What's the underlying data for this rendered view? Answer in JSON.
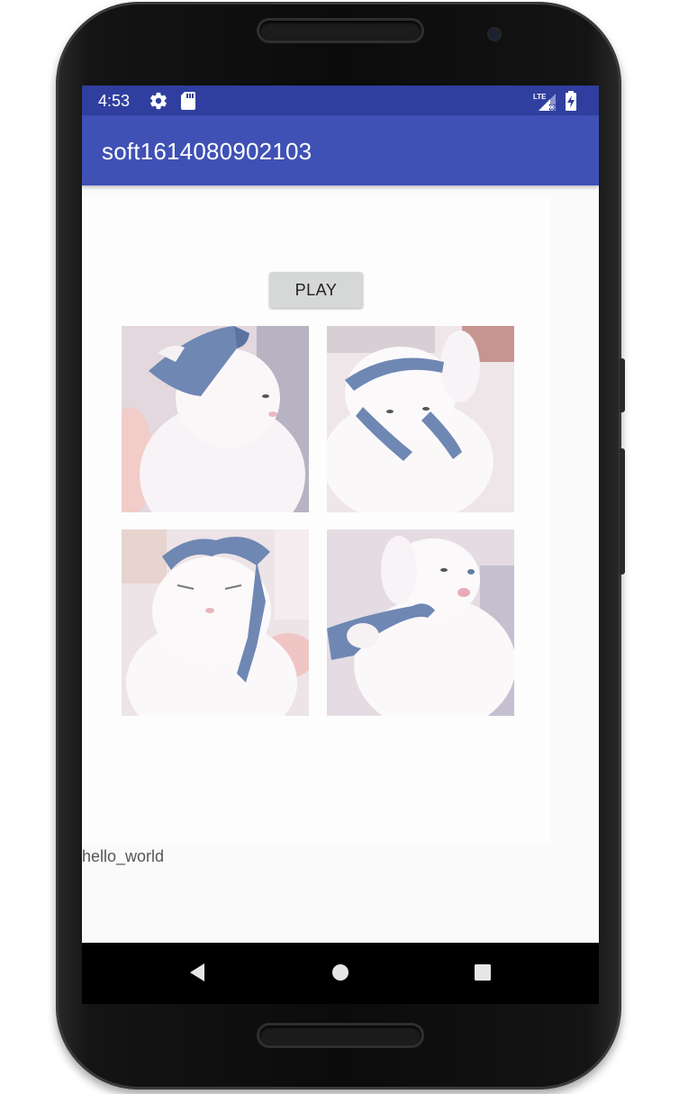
{
  "status_bar": {
    "time": "4:53",
    "icons": [
      "settings-gear-icon",
      "sd-card-icon",
      "lte-signal-icon",
      "battery-charging-icon"
    ],
    "network_label": "LTE",
    "color": "#303f9f"
  },
  "app_bar": {
    "title": "soft1614080902103",
    "color": "#3f51b5"
  },
  "main": {
    "play_button_label": "PLAY",
    "images": [
      {
        "name": "white cat with blue cloth on head, looking right"
      },
      {
        "name": "white cat pawing at blue cloth band"
      },
      {
        "name": "white cat with blue cloth, eyes squinting"
      },
      {
        "name": "white cat biting blue cloth, paw raised"
      }
    ],
    "hello_text": "hello_world"
  },
  "nav_bar": {
    "buttons": [
      "back-icon",
      "home-icon",
      "recents-icon"
    ]
  }
}
